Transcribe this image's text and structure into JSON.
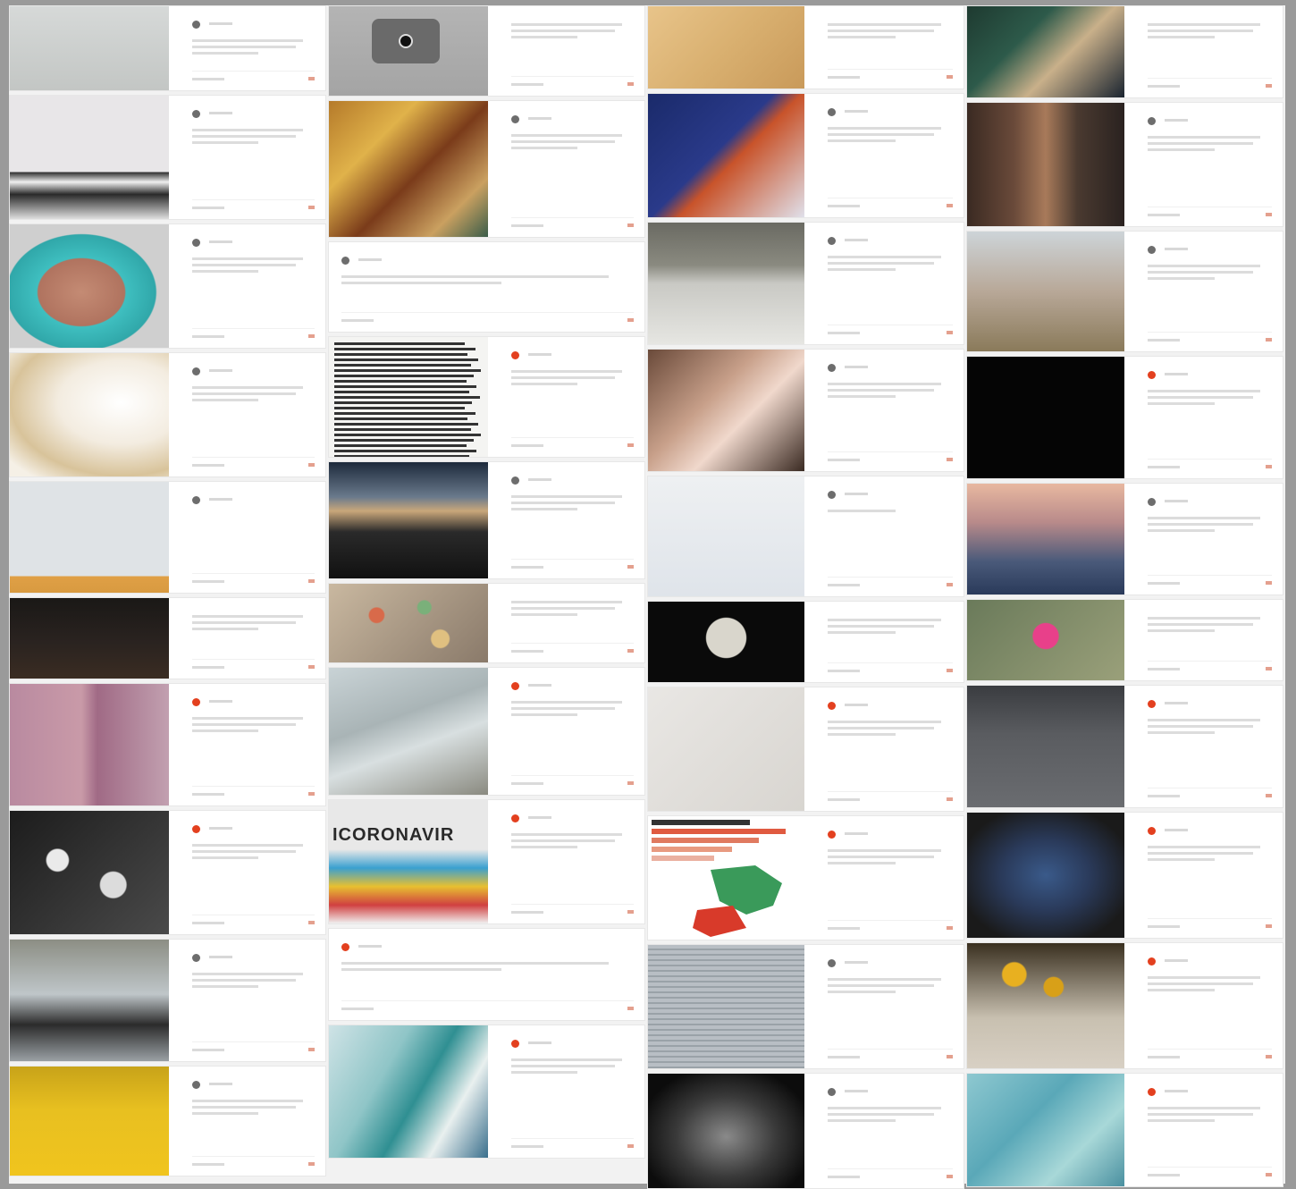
{
  "board": {
    "columns": [
      {
        "cards": [
          {
            "h": 96,
            "thumb": "photo-blue-gloved-hands",
            "title": "",
            "lines": 3,
            "avatar": "gray",
            "user": ""
          },
          {
            "h": 140,
            "thumb": "photo-clothesline-drawing",
            "title": "",
            "lines": 3,
            "avatar": "gray",
            "user": ""
          },
          {
            "h": 140,
            "thumb": "photo-painted-face-teal-hair",
            "title": "",
            "lines": 3,
            "avatar": "gray",
            "user": ""
          },
          {
            "h": 140,
            "thumb": "photo-cream-fabric",
            "title": "",
            "lines": 3,
            "avatar": "gray",
            "user": ""
          },
          {
            "h": 126,
            "thumb": "photo-bicycle-against-wall",
            "title": "",
            "lines": 0,
            "avatar": "gray",
            "user": ""
          },
          {
            "h": 92,
            "thumb": "photo-night-city-lights",
            "title": "",
            "lines": 3,
            "avatar": "none",
            "user": ""
          },
          {
            "h": 138,
            "thumb": "photo-pink-window-facade",
            "title": "",
            "lines": 3,
            "avatar": "red",
            "user": ""
          },
          {
            "h": 140,
            "thumb": "photo-bw-flower-pattern",
            "title": "",
            "lines": 3,
            "avatar": "red",
            "user": ""
          },
          {
            "h": 138,
            "thumb": "photo-person-reading-outdoors",
            "title": "",
            "lines": 3,
            "avatar": "gray",
            "user": ""
          },
          {
            "h": 124,
            "thumb": "photo-yellow-flower-field",
            "title": "",
            "lines": 3,
            "avatar": "gray",
            "user": ""
          }
        ]
      },
      {
        "cards": [
          {
            "h": 102,
            "thumb": "photo-gray-camera-app",
            "title": "",
            "lines": 3,
            "avatar": "none",
            "user": ""
          },
          {
            "h": 154,
            "thumb": "photo-two-women-painting",
            "title": "",
            "lines": 3,
            "avatar": "gray",
            "user": ""
          },
          {
            "h": 102,
            "thumb": "",
            "title": "",
            "lines": 2,
            "avatar": "gray",
            "user": ""
          },
          {
            "h": 136,
            "thumb": "text-page-scan",
            "title": "",
            "lines": 3,
            "avatar": "red",
            "user": ""
          },
          {
            "h": 132,
            "thumb": "photo-sunset-clouds",
            "title": "",
            "lines": 3,
            "avatar": "gray",
            "user": ""
          },
          {
            "h": 90,
            "thumb": "photo-colorful-beads",
            "title": "",
            "lines": 3,
            "avatar": "none",
            "user": ""
          },
          {
            "h": 144,
            "thumb": "photo-rumpled-bedsheet",
            "title": "",
            "lines": 3,
            "avatar": "red",
            "user": ""
          },
          {
            "h": 140,
            "thumb": "photo-coronavirus-collage",
            "title": "",
            "lines": 3,
            "avatar": "red",
            "user": "",
            "banner": "ICORONAVIR"
          },
          {
            "h": 104,
            "thumb": "",
            "title": "",
            "lines": 2,
            "avatar": "red",
            "user": ""
          },
          {
            "h": 150,
            "thumb": "photo-woman-ocean-wave",
            "title": "",
            "lines": 3,
            "avatar": "red",
            "user": ""
          }
        ]
      },
      {
        "cards": [
          {
            "h": 94,
            "thumb": "photo-old-map-paper",
            "title": "",
            "lines": 3,
            "avatar": "none",
            "user": ""
          },
          {
            "h": 140,
            "thumb": "illustration-cartoon-dogs",
            "title": "",
            "lines": 3,
            "avatar": "gray",
            "user": ""
          },
          {
            "h": 138,
            "thumb": "photo-bridge-over-river",
            "title": "",
            "lines": 3,
            "avatar": "gray",
            "user": ""
          },
          {
            "h": 138,
            "thumb": "photo-papers-on-desk",
            "title": "",
            "lines": 3,
            "avatar": "gray",
            "user": ""
          },
          {
            "h": 136,
            "thumb": "photo-blue-window-figure",
            "title": "",
            "lines": 1,
            "avatar": "gray",
            "user": ""
          },
          {
            "h": 92,
            "thumb": "photo-full-moon",
            "title": "",
            "lines": 3,
            "avatar": "none",
            "user": ""
          },
          {
            "h": 140,
            "thumb": "photo-cracked-plaster",
            "title": "",
            "lines": 3,
            "avatar": "red",
            "user": ""
          },
          {
            "h": 140,
            "thumb": "chart-europe-map",
            "title": "",
            "lines": 3,
            "avatar": "red",
            "user": ""
          },
          {
            "h": 140,
            "thumb": "photo-handwritten-notes",
            "title": "",
            "lines": 3,
            "avatar": "gray",
            "user": ""
          },
          {
            "h": 130,
            "thumb": "photo-dark-rock",
            "title": "",
            "lines": 3,
            "avatar": "gray",
            "user": ""
          }
        ]
      },
      {
        "cards": [
          {
            "h": 104,
            "thumb": "photo-green-painting",
            "title": "",
            "lines": 3,
            "avatar": "none",
            "user": ""
          },
          {
            "h": 140,
            "thumb": "photo-street-with-flags",
            "title": "",
            "lines": 3,
            "avatar": "gray",
            "user": ""
          },
          {
            "h": 136,
            "thumb": "photo-old-couple-outdoors",
            "title": "",
            "lines": 3,
            "avatar": "gray",
            "user": ""
          },
          {
            "h": 138,
            "thumb": "quote-white-on-black",
            "title": "",
            "lines": 3,
            "avatar": "red",
            "user": ""
          },
          {
            "h": 126,
            "thumb": "photo-sunset-reflection",
            "title": "",
            "lines": 3,
            "avatar": "gray",
            "user": ""
          },
          {
            "h": 92,
            "thumb": "photo-pink-flower",
            "title": "",
            "lines": 3,
            "avatar": "none",
            "user": ""
          },
          {
            "h": 138,
            "thumb": "photo-bird-on-road",
            "title": "",
            "lines": 3,
            "avatar": "red",
            "user": ""
          },
          {
            "h": 142,
            "thumb": "photo-overgrown-tree",
            "title": "",
            "lines": 3,
            "avatar": "red",
            "user": ""
          },
          {
            "h": 142,
            "thumb": "photo-sunflowers-vase",
            "title": "",
            "lines": 3,
            "avatar": "red",
            "user": ""
          },
          {
            "h": 128,
            "thumb": "painting-blue-figures",
            "title": "",
            "lines": 3,
            "avatar": "red",
            "user": ""
          }
        ]
      }
    ]
  },
  "quote_card": {
    "lines": [
      "",
      "",
      "",
      "",
      ""
    ]
  },
  "colors": {
    "accent": "#e3401f",
    "frame": "#9a9a9a",
    "board": "#f2f2f2"
  }
}
